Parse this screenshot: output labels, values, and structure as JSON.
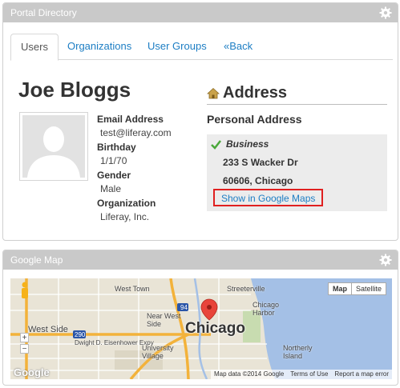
{
  "directory_portlet": {
    "title": "Portal Directory",
    "tabs": [
      {
        "label": "Users",
        "active": true
      },
      {
        "label": "Organizations",
        "active": false
      },
      {
        "label": "User Groups",
        "active": false
      },
      {
        "label": "«Back",
        "active": false
      }
    ],
    "user": {
      "name": "Joe Bloggs",
      "fields": [
        {
          "label": "Email Address",
          "value": "test@liferay.com"
        },
        {
          "label": "Birthday",
          "value": "1/1/70"
        },
        {
          "label": "Gender",
          "value": "Male"
        },
        {
          "label": "Organization",
          "value": "Liferay, Inc."
        }
      ]
    },
    "address": {
      "heading": "Address",
      "subheading": "Personal Address",
      "type": "Business",
      "street": "233 S Wacker Dr",
      "city_line": "60606, Chicago",
      "map_link": "Show in Google Maps"
    }
  },
  "map_portlet": {
    "title": "Google Map",
    "map_type_buttons": [
      {
        "label": "Map",
        "selected": true
      },
      {
        "label": "Satellite",
        "selected": false
      }
    ],
    "city_label": "Chicago",
    "place_labels": [
      "West Town",
      "Streeterville",
      "Chicago Harbor",
      "Near West Side",
      "West Side",
      "University Village",
      "Northerly Island",
      "Dwight D. Eisenhower Expy"
    ],
    "highway_labels": [
      "94",
      "290"
    ],
    "logo": "Google",
    "footer": [
      "Map data ©2014 Google",
      "Terms of Use",
      "Report a map error"
    ],
    "zoom": [
      "+",
      "−"
    ]
  },
  "colors": {
    "header": "#c9c9c9",
    "link": "#1d7ec4",
    "highlight_border": "#e02020",
    "address_box": "#ececec"
  }
}
